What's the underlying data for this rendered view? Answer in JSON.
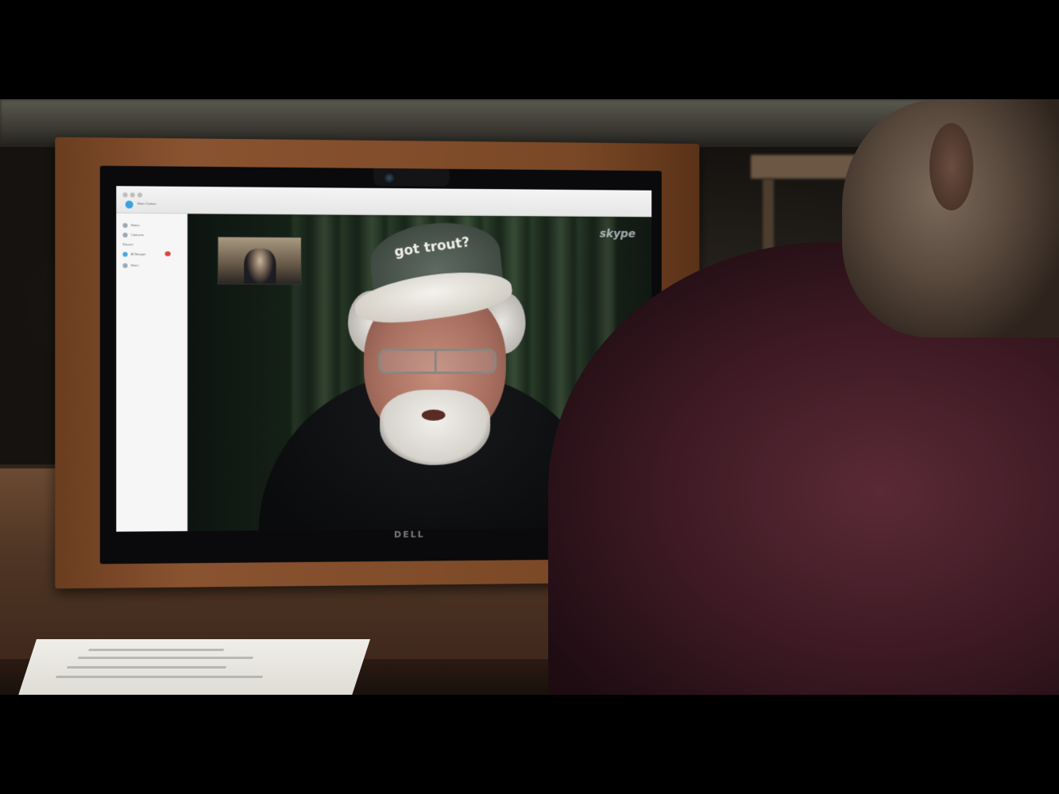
{
  "skype_window": {
    "profile_name": "Henri Camus",
    "sidebar_items": [
      {
        "label": "Home"
      },
      {
        "label": "Contacts"
      },
      {
        "label": "Recent"
      },
      {
        "label": "Al Swager"
      },
      {
        "label": "Henri"
      }
    ],
    "watermark": "skype"
  },
  "remote_video": {
    "cap_text": "got trout?"
  },
  "monitor": {
    "brand": "DELL"
  }
}
